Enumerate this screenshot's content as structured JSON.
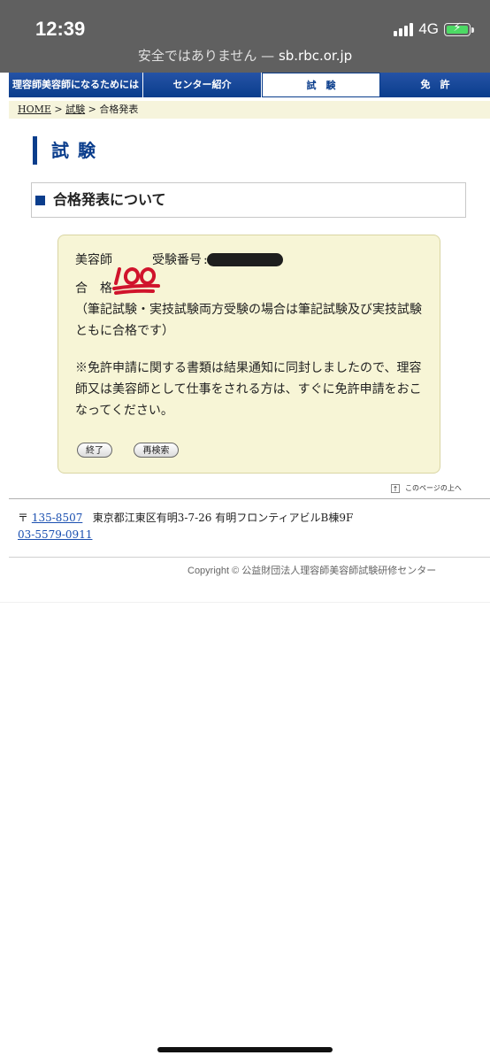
{
  "status_bar": {
    "time": "12:39",
    "network": "4G",
    "battery_icon": "battery-charging-icon",
    "signal_icon": "signal-bars-icon"
  },
  "browser": {
    "insecure_label": "安全ではありません —",
    "host": "sb.rbc.or.jp"
  },
  "nav": {
    "items": [
      "理容師美容師になるためには",
      "センター紹介",
      "試　験",
      "免　許"
    ]
  },
  "breadcrumb": {
    "home": "HOME",
    "sep1": " > ",
    "exam": "試験",
    "sep2": " > ",
    "current": "合格発表"
  },
  "page_title": "試験",
  "section_title": "合格発表について",
  "result": {
    "license_type": "美容師",
    "exam_number_label": "受験番号",
    "pass_label": "合　格",
    "emoji_icon": "hundred-points-icon",
    "note": "（筆記試験・実技試験両方受験の場合は筆記試験及び実技試験ともに合格です）",
    "notice": "※免許申請に関する書類は結果通知に同封しましたので、理容師又は美容師として仕事をされる方は、すぐに免許申請をおこなってください。",
    "end_button": "終了",
    "research_button": "再検索"
  },
  "page_top": {
    "icon": "arrow-up-box-icon",
    "label": "このページの上へ"
  },
  "footer": {
    "postal_mark": "〒",
    "postal_code": "135-8507",
    "address": "東京都江東区有明3-7-26 有明フロンティアビルB棟9F",
    "phone": "03-5579-0911",
    "copyright": "Copyright © 公益財団法人理容師美容師試験研修センター"
  },
  "colors": {
    "brand_blue": "#0a3d8c",
    "panel_bg": "#f7f5d6",
    "browser_chrome": "#606060"
  }
}
